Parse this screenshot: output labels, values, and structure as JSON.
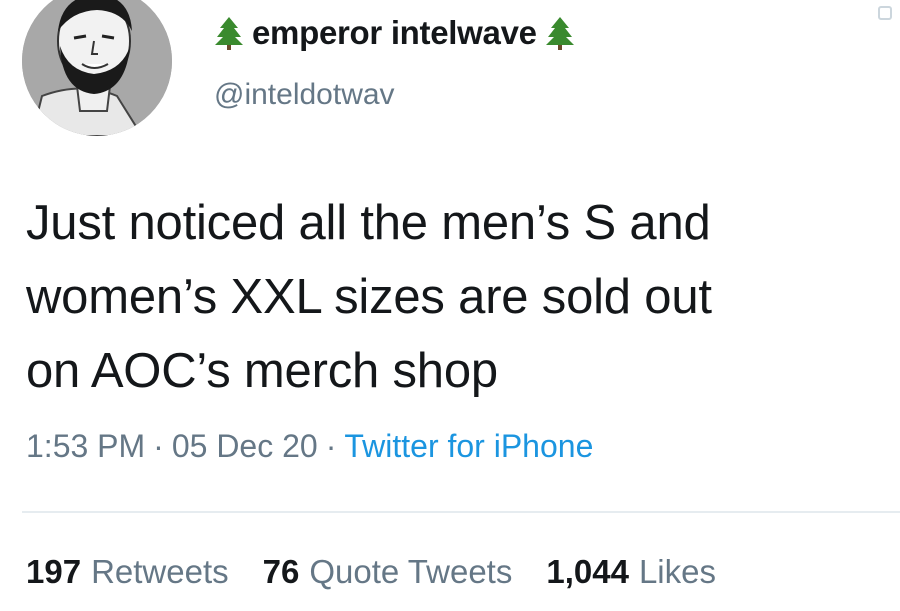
{
  "author": {
    "display_name": "emperor intelwave",
    "handle": "@inteldotwav",
    "avatar_icon": "bearded-man-avatar",
    "name_decoration_icon": "evergreen-tree-icon"
  },
  "tweet": {
    "text": "Just noticed all the men’s S and\nwomen’s XXL sizes are sold out\non AOC’s merch shop"
  },
  "meta": {
    "time": "1:53 PM",
    "separator": "·",
    "date": "05 Dec 20",
    "source": "Twitter for iPhone"
  },
  "stats": {
    "retweets_count": "197",
    "retweets_label": "Retweets",
    "quotes_count": "76",
    "quotes_label": "Quote Tweets",
    "likes_count": "1,044",
    "likes_label": "Likes"
  },
  "colors": {
    "text_primary": "#14171a",
    "text_secondary": "#657786",
    "link": "#1b95e0",
    "divider": "#e6ecf0"
  }
}
